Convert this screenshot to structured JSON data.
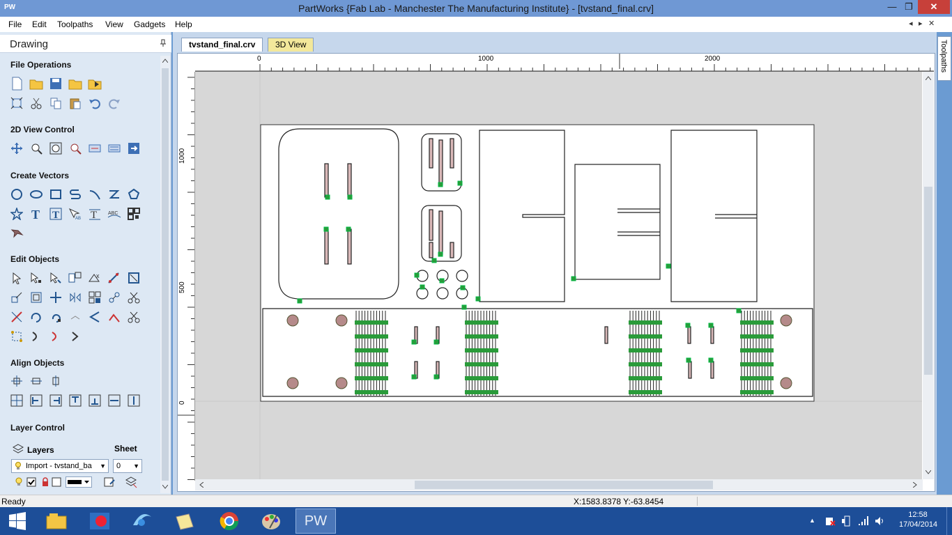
{
  "window": {
    "app_icon_text": "PW",
    "title": "PartWorks {Fab Lab - Manchester The Manufacturing Institute} - [tvstand_final.crv]",
    "min_glyph": "—",
    "restore_glyph": "❐",
    "close_glyph": "✕"
  },
  "menu": {
    "items": [
      "File",
      "Edit",
      "Toolpaths",
      "View",
      "Gadgets",
      "Help"
    ],
    "mdi_prev": "◂",
    "mdi_next": "▸",
    "mdi_close": "✕"
  },
  "panel": {
    "title": "Drawing",
    "pin_glyph": "📌",
    "sections": {
      "file_ops": "File Operations",
      "view_control": "2D View Control",
      "create_vectors": "Create Vectors",
      "edit_objects": "Edit Objects",
      "align_objects": "Align Objects",
      "layer_control": "Layer Control"
    },
    "layers_label": "Layers",
    "sheet_label": "Sheet",
    "layer_value": "Import - tvstand_ba",
    "sheet_value": "0"
  },
  "tabs": {
    "active": "tvstand_final.crv",
    "view3d": "3D View",
    "toolpaths": "Toolpaths"
  },
  "ruler": {
    "h_labels": [
      "0",
      "1000",
      "2000"
    ],
    "v_labels": [
      "1000",
      "500",
      "0"
    ]
  },
  "status": {
    "left": "Ready",
    "coords": "X:1583.8378 Y:-63.8454"
  },
  "taskbar": {
    "pw_label": "PW",
    "time": "12:58",
    "date": "17/04/2014"
  },
  "colors": {
    "titlebar": "#6f98d4",
    "panel": "#dde8f4",
    "taskbar": "#1d4e98",
    "close": "#c7403a",
    "node": "#2a9b3a"
  }
}
